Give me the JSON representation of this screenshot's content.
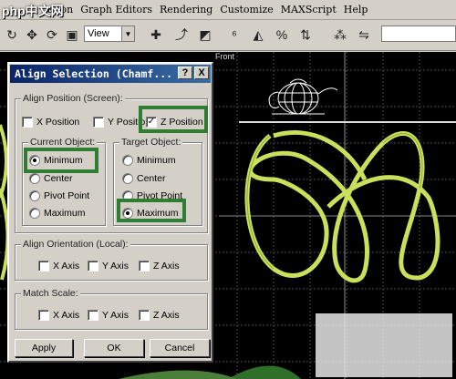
{
  "logo": "php中文网",
  "menu": [
    "ation",
    "Graph Editors",
    "Rendering",
    "Customize",
    "MAXScript",
    "Help"
  ],
  "toolbar": {
    "view_select": "View"
  },
  "viewport": {
    "label": "Front"
  },
  "dialog": {
    "title": "Align Selection (Chamf...",
    "help_btn": "?",
    "close_btn": "X",
    "align_position_title": "Align Position (Screen):",
    "x_position": "X Position",
    "y_position": "Y Position",
    "z_position": "Z Position",
    "z_checked": "✓",
    "current_object_title": "Current Object:",
    "target_object_title": "Target Object:",
    "current_options": [
      "Minimum",
      "Center",
      "Pivot Point",
      "Maximum"
    ],
    "target_options": [
      "Minimum",
      "Center",
      "Pivot Point",
      "Maximum"
    ],
    "current_selected": "Minimum",
    "target_selected": "Maximum",
    "align_orientation_title": "Align Orientation (Local):",
    "orient_x": "X Axis",
    "orient_y": "Y Axis",
    "orient_z": "Z Axis",
    "match_scale_title": "Match Scale:",
    "scale_x": "X Axis",
    "scale_y": "Y Axis",
    "scale_z": "Z Axis",
    "apply": "Apply",
    "ok": "OK",
    "cancel": "Cancel"
  },
  "colors": {
    "highlight": "#2e7d32",
    "wire_yellow": "#c8e05a",
    "title_blue": "#0a246a"
  }
}
